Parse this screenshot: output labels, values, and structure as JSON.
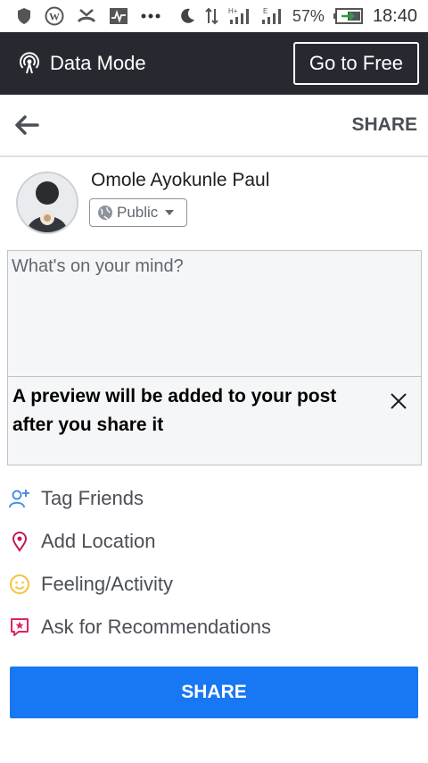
{
  "status_bar": {
    "battery": "57%",
    "time": "18:40",
    "icons": [
      "shield-icon",
      "wordpress-icon",
      "missed-call-icon",
      "activity-icon",
      "more-dots-icon",
      "moon-icon",
      "data-arrows-icon",
      "signal-h-icon",
      "signal-e-icon",
      "battery-icon"
    ]
  },
  "data_bar": {
    "label": "Data Mode",
    "button": "Go to Free"
  },
  "header": {
    "share": "SHARE"
  },
  "author": {
    "name": "Omole Ayokunle Paul",
    "privacy": "Public"
  },
  "composer": {
    "placeholder": "What's on your mind?"
  },
  "preview": {
    "text": "A preview will be added to your post after you share it"
  },
  "options": [
    {
      "label": "Tag Friends",
      "icon": "tag-friends-icon",
      "color": "#4a8fe7"
    },
    {
      "label": "Add Location",
      "icon": "location-pin-icon",
      "color": "#c2185b"
    },
    {
      "label": "Feeling/Activity",
      "icon": "smiley-icon",
      "color": "#f5c33b"
    },
    {
      "label": "Ask for Recommendations",
      "icon": "recommendation-icon",
      "color": "#e0245e"
    }
  ],
  "share_button": "SHARE",
  "colors": {
    "accent": "#1877f2",
    "data_bar_bg": "#262a30"
  }
}
